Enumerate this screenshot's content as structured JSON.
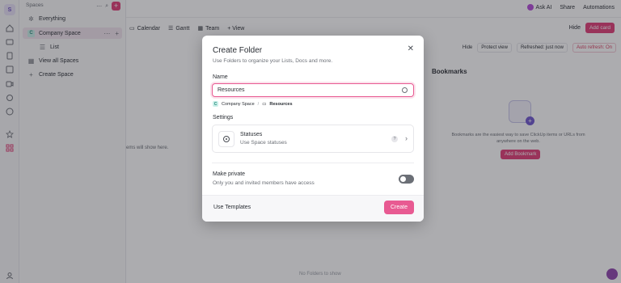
{
  "rail": {
    "workspace_initial": "S"
  },
  "sidebar": {
    "header": "Spaces",
    "items": [
      {
        "label": "Everything",
        "icon": "asterisk-icon"
      },
      {
        "label": "Company Space",
        "badge": "C",
        "icon": "space-badge"
      },
      {
        "label": "List",
        "icon": "list-icon"
      },
      {
        "label": "View all Spaces",
        "icon": "grid-icon"
      },
      {
        "label": "Create Space",
        "icon": "plus-icon"
      }
    ]
  },
  "topbar": {
    "ask_ai": "Ask AI",
    "share": "Share",
    "automations": "Automations"
  },
  "viewbar": {
    "tabs": [
      "Calendar",
      "Gantt",
      "Team",
      "+ View"
    ],
    "hide": "Hide",
    "add_card": "Add card"
  },
  "toolbar": {
    "hide": "Hide",
    "protect_view": "Protect view",
    "refreshed": "Refreshed: just now",
    "auto_refresh": "Auto refresh: On"
  },
  "bookmarks": {
    "title": "Bookmarks",
    "description": "Bookmarks are the easiest way to save ClickUp items or URLs from anywhere on the web.",
    "button": "Add Bookmark"
  },
  "background": {
    "left_empty": "ems will show here.",
    "no_folders": "No Folders to show"
  },
  "modal": {
    "title": "Create Folder",
    "subtitle": "Use Folders to organize your Lists, Docs and more.",
    "name_label": "Name",
    "name_value": "Resources",
    "breadcrumb": {
      "space_badge": "C",
      "space": "Company Space",
      "separator": "/",
      "folder": "Resources"
    },
    "settings_label": "Settings",
    "statuses": {
      "title": "Statuses",
      "subtitle": "Use Space statuses",
      "help": "?"
    },
    "private": {
      "title": "Make private",
      "subtitle": "Only you and invited members have access",
      "enabled": false
    },
    "footer": {
      "templates": "Use Templates",
      "create": "Create"
    }
  },
  "colors": {
    "accent": "#e85a92",
    "overlay": "#24262e"
  }
}
